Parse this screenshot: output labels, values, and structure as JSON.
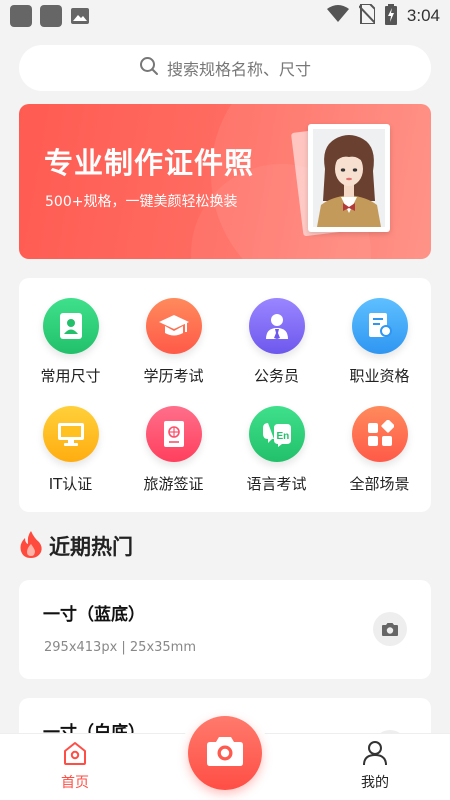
{
  "status_bar": {
    "time": "3:04"
  },
  "search": {
    "placeholder": "搜索规格名称、尺寸"
  },
  "banner": {
    "title": "专业制作证件照",
    "subtitle": "500+规格，一键美颜轻松换装"
  },
  "categories": [
    {
      "label": "常用尺寸",
      "icon": "id-card-icon",
      "color": "#2dcf7a"
    },
    {
      "label": "学历考试",
      "icon": "graduation-cap-icon",
      "color": "#ff6a50"
    },
    {
      "label": "公务员",
      "icon": "person-tie-icon",
      "color": "#7c68f2"
    },
    {
      "label": "职业资格",
      "icon": "certificate-icon",
      "color": "#3ea9f8"
    },
    {
      "label": "IT认证",
      "icon": "monitor-icon",
      "color": "#ffbd1f"
    },
    {
      "label": "旅游签证",
      "icon": "passport-icon",
      "color": "#ff4f6c"
    },
    {
      "label": "语言考试",
      "icon": "speech-en-icon",
      "color": "#2dcf7a"
    },
    {
      "label": "全部场景",
      "icon": "grid-apps-icon",
      "color": "#ff6a50"
    }
  ],
  "hot": {
    "title": "近期热门",
    "items": [
      {
        "name": "一寸（蓝底）",
        "spec": "295x413px | 25x35mm"
      },
      {
        "name": "一寸（白底）",
        "spec": ""
      }
    ]
  },
  "nav": {
    "home_label": "首页",
    "mine_label": "我的",
    "active_color": "#ff4e45"
  }
}
